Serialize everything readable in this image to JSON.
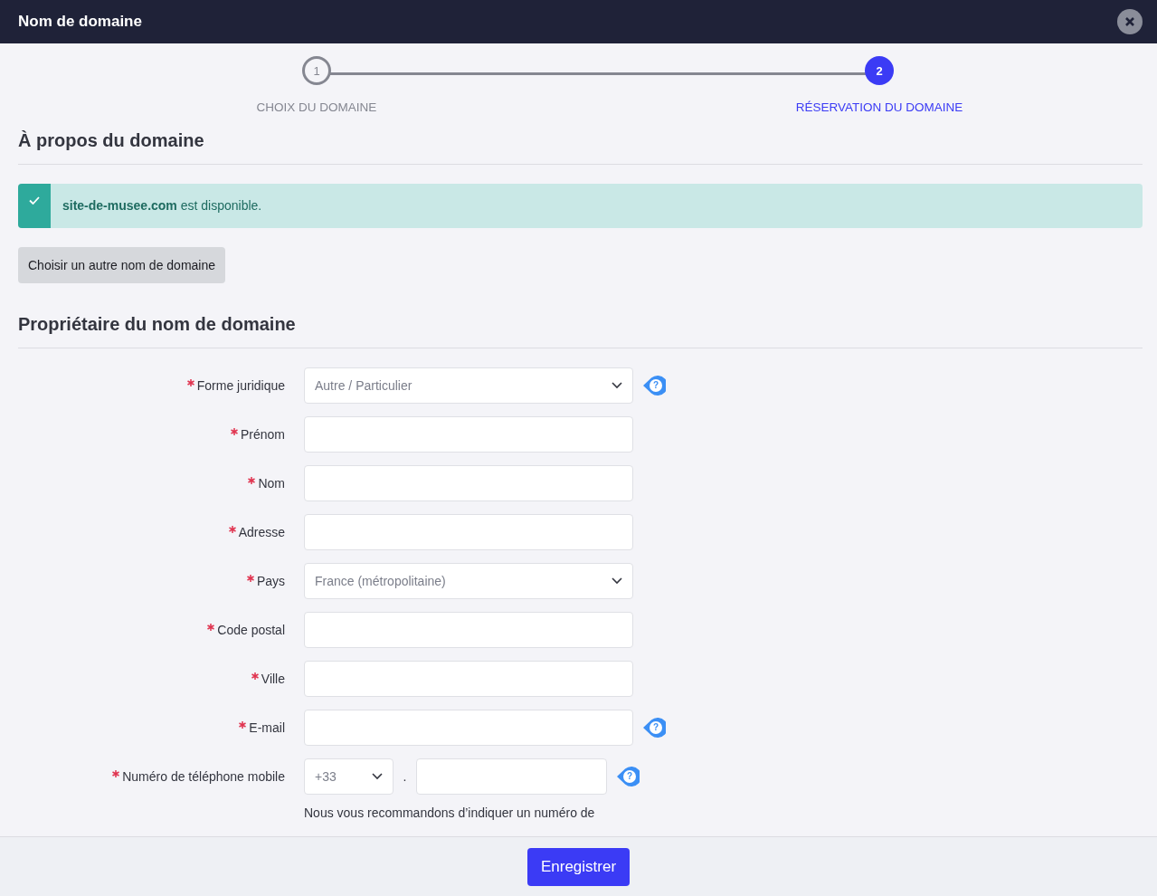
{
  "window": {
    "title": "Nom de domaine"
  },
  "steps": [
    {
      "number": "1",
      "label": "CHOIX DU DOMAINE",
      "selected": false
    },
    {
      "number": "2",
      "label": "RÉSERVATION DU DOMAINE",
      "selected": true
    }
  ],
  "about": {
    "heading": "À propos du domaine",
    "alert": "**site-de-musee.com** est disponible.",
    "button": "Choisir un autre nom de domaine"
  },
  "owner": {
    "heading": "Propriétaire du nom de domaine",
    "fields": [
      {
        "kind": "select",
        "label": "Forme juridique",
        "value": "Autre / Particulier",
        "required": true,
        "help": "?"
      },
      {
        "kind": "text",
        "label": "Prénom",
        "required": true
      },
      {
        "kind": "text",
        "label": "Nom",
        "required": true
      },
      {
        "kind": "text",
        "label": "Adresse",
        "required": true
      },
      {
        "kind": "select",
        "label": "Pays",
        "value": "France (métropolitaine)",
        "required": true
      },
      {
        "kind": "text",
        "label": "Code postal",
        "required": true
      },
      {
        "kind": "text",
        "label": "Ville",
        "required": true
      },
      {
        "kind": "text",
        "label": "E-mail",
        "required": true,
        "help": "?"
      },
      {
        "kind": "phone",
        "label": "Numéro de téléphone mobile",
        "value": "+33",
        "separator": ".",
        "required": true,
        "help": "?"
      }
    ],
    "note": "Nous vous recommandons d’indiquer un numéro de"
  },
  "footer": {
    "button": "Enregistrer"
  }
}
